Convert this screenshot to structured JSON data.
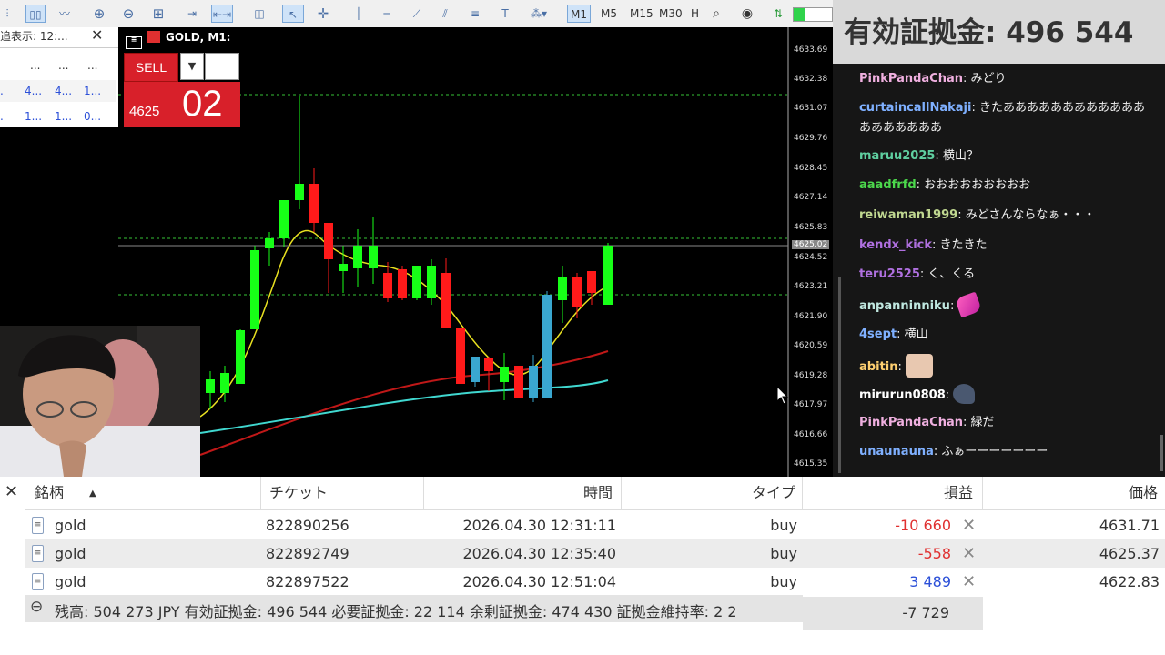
{
  "toolbar": {
    "timeframes": [
      {
        "label": "M1",
        "selected": true
      },
      {
        "label": "M5",
        "selected": false
      },
      {
        "label": "M15",
        "selected": false
      },
      {
        "label": "M30",
        "selected": false
      },
      {
        "label": "H",
        "selected": false
      }
    ],
    "progress_fraction": 0.3
  },
  "market_watch": {
    "title": "追表示: 12:...",
    "rows": [
      [
        "...",
        "...",
        "..."
      ],
      [
        "4...",
        "4...",
        "1..."
      ],
      [
        "1...",
        "1...",
        "0..."
      ]
    ]
  },
  "chart": {
    "title": "GOLD, M1:",
    "sell_label": "SELL",
    "price_big": "02",
    "price_small": "4625",
    "current_price_label": "4625.02",
    "y_labels": [
      "4633.69",
      "4632.38",
      "4631.07",
      "4629.76",
      "4628.45",
      "4627.14",
      "4625.83",
      "4624.52",
      "4623.21",
      "4621.90",
      "4620.59",
      "4619.28",
      "4617.97",
      "4616.66",
      "4615.35"
    ],
    "colors": {
      "bull": "#17ff17",
      "bear": "#ff1a1a",
      "neutral": "#3aa7d0",
      "ma_fast": "#e8e020",
      "ma_mid": "#c01818",
      "ma_slow": "#40d8d0",
      "level": "#36c236"
    }
  },
  "overlay": {
    "text": "有効証拠金: 496 544"
  },
  "chat": {
    "messages": [
      {
        "user": "PinkPandaChan",
        "color": "#f0b0e0",
        "text": "みどり"
      },
      {
        "user": "curtaincallNakaji",
        "color": "#7fb0ff",
        "text": "きたあああああああああああああああああああ"
      },
      {
        "user": "maruu2025",
        "color": "#5fcfa0",
        "text": "横山？"
      },
      {
        "user": "aaadfrfd",
        "color": "#4cd84c",
        "text": "おおおおおおおおお"
      },
      {
        "user": "reiwaman1999",
        "color": "#c0d890",
        "text": "みどさんならなぁ・・・"
      },
      {
        "user": "kendx_kick",
        "color": "#b070e0",
        "text": "きたきた"
      },
      {
        "user": "teru2525",
        "color": "#b070e0",
        "text": "く、くる"
      },
      {
        "user": "anpanninniku",
        "color": "#c0e8e0",
        "text": ""
      },
      {
        "user": "4sept",
        "color": "#7fb0ff",
        "text": "横山"
      },
      {
        "user": "abitin",
        "color": "#ffd070",
        "text": ""
      },
      {
        "user": "mirurun0808",
        "color": "#ffffff",
        "text": ""
      },
      {
        "user": "PinkPandaChan",
        "color": "#f0b0e0",
        "text": "緑だ"
      },
      {
        "user": "unaunauna",
        "color": "#7fb0ff",
        "text": "ふぁーーーーーーー"
      }
    ]
  },
  "terminal": {
    "headers": {
      "symbol": "銘柄",
      "ticket": "チケット",
      "time": "時間",
      "type": "タイプ",
      "profit": "損益",
      "price": "価格"
    },
    "rows": [
      {
        "symbol": "gold",
        "ticket": "822890256",
        "time": "2026.04.30 12:31:11",
        "type": "buy",
        "profit": "-10 660",
        "profit_color": "#e03030",
        "price": "4631.71"
      },
      {
        "symbol": "gold",
        "ticket": "822892749",
        "time": "2026.04.30 12:35:40",
        "type": "buy",
        "profit": "-558",
        "profit_color": "#e03030",
        "price": "4625.37"
      },
      {
        "symbol": "gold",
        "ticket": "822897522",
        "time": "2026.04.30 12:51:04",
        "type": "buy",
        "profit": "3 489",
        "profit_color": "#2c50d8",
        "price": "4622.83"
      }
    ],
    "status": "残高: 504 273 JPY  有効証拠金: 496 544  必要証拠金: 22 114  余剰証拠金: 474 430  証拠金維持率: 2 2",
    "total_profit": "-7 729"
  }
}
